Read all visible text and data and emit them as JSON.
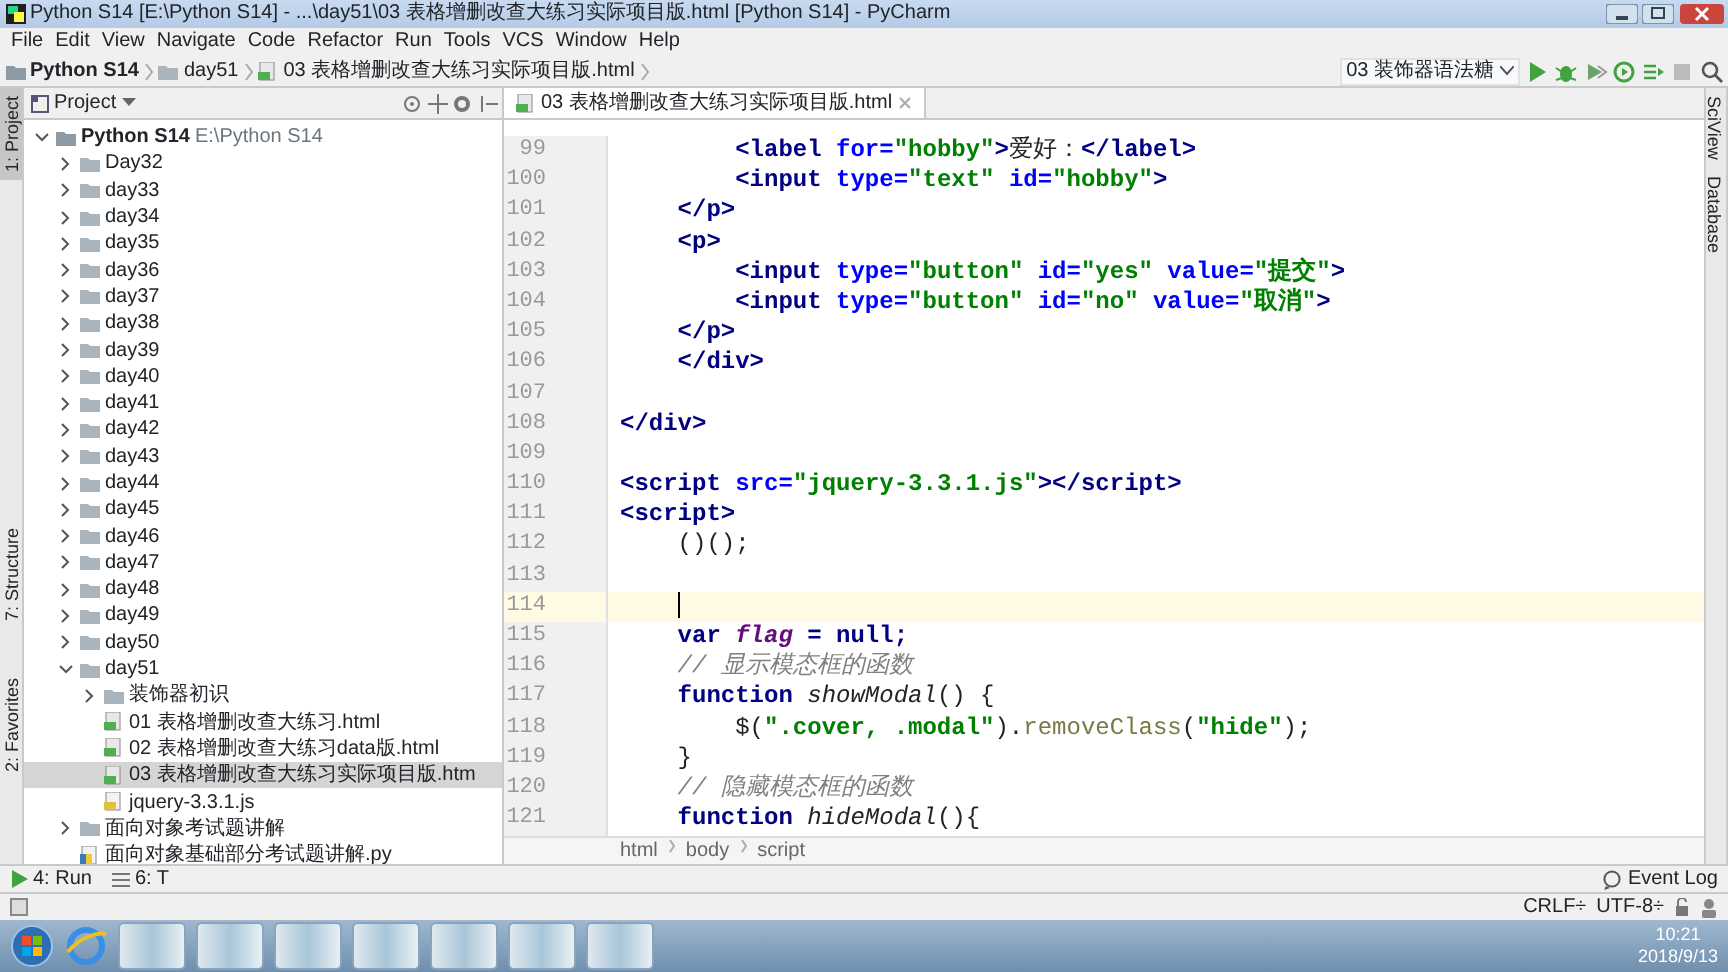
{
  "window": {
    "title": "Python S14 [E:\\Python S14] - ...\\day51\\03 表格增删改查大练习实际项目版.html [Python S14] - PyCharm"
  },
  "menu": [
    "File",
    "Edit",
    "View",
    "Navigate",
    "Code",
    "Refactor",
    "Run",
    "Tools",
    "VCS",
    "Window",
    "Help"
  ],
  "navbar": {
    "crumbs": [
      {
        "label": "Python S14",
        "kind": "project"
      },
      {
        "label": "day51",
        "kind": "folder"
      },
      {
        "label": "03 表格增删改查大练习实际项目版.html",
        "kind": "html"
      }
    ],
    "run_config": "03 装饰器语法糖"
  },
  "left_stripe": [
    {
      "label": "1: Project",
      "selected": true
    },
    {
      "label": "7: Structure",
      "selected": false
    },
    {
      "label": "2: Favorites",
      "selected": false
    }
  ],
  "right_stripe": [
    {
      "label": "SciView"
    },
    {
      "label": "Database"
    }
  ],
  "project_panel": {
    "title": "Project",
    "tree": [
      {
        "label": "Python S14",
        "path": "E:\\Python S14",
        "kind": "project",
        "expanded": true,
        "selected": false,
        "children": [
          {
            "label": "Day32",
            "kind": "folder",
            "expanded": false,
            "selected": false
          },
          {
            "label": "day33",
            "kind": "folder",
            "expanded": false,
            "selected": false
          },
          {
            "label": "day34",
            "kind": "folder",
            "expanded": false,
            "selected": false
          },
          {
            "label": "day35",
            "kind": "folder",
            "expanded": false,
            "selected": false
          },
          {
            "label": "day36",
            "kind": "folder",
            "expanded": false,
            "selected": false
          },
          {
            "label": "day37",
            "kind": "folder",
            "expanded": false,
            "selected": false
          },
          {
            "label": "day38",
            "kind": "folder",
            "expanded": false,
            "selected": false
          },
          {
            "label": "day39",
            "kind": "folder",
            "expanded": false,
            "selected": false
          },
          {
            "label": "day40",
            "kind": "folder",
            "expanded": false,
            "selected": false
          },
          {
            "label": "day41",
            "kind": "folder",
            "expanded": false,
            "selected": false
          },
          {
            "label": "day42",
            "kind": "folder",
            "expanded": false,
            "selected": false
          },
          {
            "label": "day43",
            "kind": "folder",
            "expanded": false,
            "selected": false
          },
          {
            "label": "day44",
            "kind": "folder",
            "expanded": false,
            "selected": false
          },
          {
            "label": "day45",
            "kind": "folder",
            "expanded": false,
            "selected": false
          },
          {
            "label": "day46",
            "kind": "folder",
            "expanded": false,
            "selected": false
          },
          {
            "label": "day47",
            "kind": "folder",
            "expanded": false,
            "selected": false
          },
          {
            "label": "day48",
            "kind": "folder",
            "expanded": false,
            "selected": false
          },
          {
            "label": "day49",
            "kind": "folder",
            "expanded": false,
            "selected": false
          },
          {
            "label": "day50",
            "kind": "folder",
            "expanded": false,
            "selected": false
          },
          {
            "label": "day51",
            "kind": "folder",
            "expanded": true,
            "selected": false,
            "children": [
              {
                "label": "装饰器初识",
                "kind": "folder",
                "expanded": false,
                "selected": false
              },
              {
                "label": "01 表格增删改查大练习.html",
                "kind": "html",
                "selected": false
              },
              {
                "label": "02 表格增删改查大练习data版.html",
                "kind": "html",
                "selected": false
              },
              {
                "label": "03 表格增删改查大练习实际项目版.htm",
                "kind": "html",
                "selected": true
              },
              {
                "label": "jquery-3.3.1.js",
                "kind": "js",
                "selected": false
              }
            ]
          },
          {
            "label": "面向对象考试题讲解",
            "kind": "folder",
            "expanded": false,
            "selected": false
          },
          {
            "label": "面向对象基础部分考试题讲解.py",
            "kind": "py",
            "selected": false
          }
        ]
      }
    ]
  },
  "editor": {
    "tabs": [
      {
        "label": "03 表格增删改查大练习实际项目版.html",
        "selected": true
      }
    ],
    "lines": [
      {
        "number": "99",
        "current": false,
        "tokens": [
          {
            "kind": "tag",
            "t": "        <label"
          },
          {
            "kind": "attr",
            "t": " for="
          },
          {
            "kind": "str",
            "t": "\"hobby\""
          },
          {
            "kind": "tag",
            "t": ">"
          },
          {
            "kind": "text",
            "t": "爱好："
          },
          {
            "kind": "tag",
            "t": "</label>"
          }
        ]
      },
      {
        "number": "100",
        "current": false,
        "tokens": [
          {
            "kind": "tag",
            "t": "        <input"
          },
          {
            "kind": "attr",
            "t": " type="
          },
          {
            "kind": "str",
            "t": "\"text\""
          },
          {
            "kind": "attr",
            "t": " id="
          },
          {
            "kind": "str",
            "t": "\"hobby\""
          },
          {
            "kind": "tag",
            "t": ">"
          }
        ]
      },
      {
        "number": "101",
        "current": false,
        "tokens": [
          {
            "kind": "tag",
            "t": "    </p>"
          }
        ]
      },
      {
        "number": "102",
        "current": false,
        "tokens": [
          {
            "kind": "tag",
            "t": "    <p>"
          }
        ]
      },
      {
        "number": "103",
        "current": false,
        "tokens": [
          {
            "kind": "tag",
            "t": "        <input"
          },
          {
            "kind": "attr",
            "t": " type="
          },
          {
            "kind": "str",
            "t": "\"button\""
          },
          {
            "kind": "attr",
            "t": " id="
          },
          {
            "kind": "str",
            "t": "\"yes\""
          },
          {
            "kind": "attr",
            "t": " value="
          },
          {
            "kind": "str",
            "t": "\"提交\""
          },
          {
            "kind": "tag",
            "t": ">"
          }
        ]
      },
      {
        "number": "104",
        "current": false,
        "tokens": [
          {
            "kind": "tag",
            "t": "        <input"
          },
          {
            "kind": "attr",
            "t": " type="
          },
          {
            "kind": "str",
            "t": "\"button\""
          },
          {
            "kind": "attr",
            "t": " id="
          },
          {
            "kind": "str",
            "t": "\"no\""
          },
          {
            "kind": "attr",
            "t": " value="
          },
          {
            "kind": "str",
            "t": "\"取消\""
          },
          {
            "kind": "tag",
            "t": ">"
          }
        ]
      },
      {
        "number": "105",
        "current": false,
        "tokens": [
          {
            "kind": "tag",
            "t": "    </p>"
          }
        ]
      },
      {
        "number": "106",
        "current": false,
        "tokens": [
          {
            "kind": "tag",
            "t": "    </div>"
          }
        ]
      },
      {
        "number": "107",
        "current": false
      },
      {
        "number": "108",
        "current": false,
        "tokens": [
          {
            "kind": "tag",
            "t": "</div>"
          }
        ]
      },
      {
        "number": "109",
        "current": false
      },
      {
        "number": "110",
        "current": false,
        "tokens": [
          {
            "kind": "tag",
            "t": "<script"
          },
          {
            "kind": "attr",
            "t": " src="
          },
          {
            "kind": "str",
            "t": "\"jquery-3.3.1.js\""
          },
          {
            "kind": "tag",
            "t": "></script>"
          }
        ]
      },
      {
        "number": "111",
        "current": false,
        "tokens": [
          {
            "kind": "tag",
            "t": "<script>"
          }
        ]
      },
      {
        "number": "112",
        "current": false,
        "tokens": [
          {
            "kind": "text",
            "t": "    ()();"
          }
        ]
      },
      {
        "number": "113",
        "current": false
      },
      {
        "number": "114",
        "current": true
      },
      {
        "number": "115",
        "current": false,
        "tokens": [
          {
            "kind": "kw",
            "t": "    var "
          },
          {
            "kind": "var",
            "t": "flag"
          },
          {
            "kind": "kw",
            "t": " = null;"
          }
        ]
      },
      {
        "number": "116",
        "current": false,
        "tokens": [
          {
            "kind": "comment",
            "t": "    // 显示模态框的函数"
          }
        ]
      },
      {
        "number": "117",
        "current": false,
        "tokens": [
          {
            "kind": "kw",
            "t": "    function "
          },
          {
            "kind": "fn",
            "t": "showModal"
          },
          {
            "kind": "text",
            "t": "() {"
          }
        ]
      },
      {
        "number": "118",
        "current": false,
        "tokens": [
          {
            "kind": "text",
            "t": "        $("
          },
          {
            "kind": "str",
            "t": "\".cover, .modal\""
          },
          {
            "kind": "text",
            "t": ")."
          },
          {
            "kind": "method",
            "t": "removeClass"
          },
          {
            "kind": "text",
            "t": "("
          },
          {
            "kind": "str",
            "t": "\"hide\""
          },
          {
            "kind": "text",
            "t": ");"
          }
        ]
      },
      {
        "number": "119",
        "current": false,
        "tokens": [
          {
            "kind": "text",
            "t": "    }"
          }
        ]
      },
      {
        "number": "120",
        "current": false,
        "tokens": [
          {
            "kind": "comment",
            "t": "    // 隐藏模态框的函数"
          }
        ]
      },
      {
        "number": "121",
        "current": false,
        "tokens": [
          {
            "kind": "kw",
            "t": "    function "
          },
          {
            "kind": "fn",
            "t": "hideModal"
          },
          {
            "kind": "text",
            "t": "(){"
          }
        ]
      }
    ],
    "breadcrumbs": [
      "html",
      "body",
      "script"
    ]
  },
  "tool_buttons": [
    {
      "label": "4: Run",
      "kind": "run"
    },
    {
      "label": "6: T",
      "kind": "todo"
    }
  ],
  "event_log": "Event Log",
  "status_bar": {
    "line_separator": "CRLF÷",
    "encoding": "UTF-8÷"
  },
  "taskbar": {
    "time": "10:21",
    "date": "2018/9/13"
  }
}
